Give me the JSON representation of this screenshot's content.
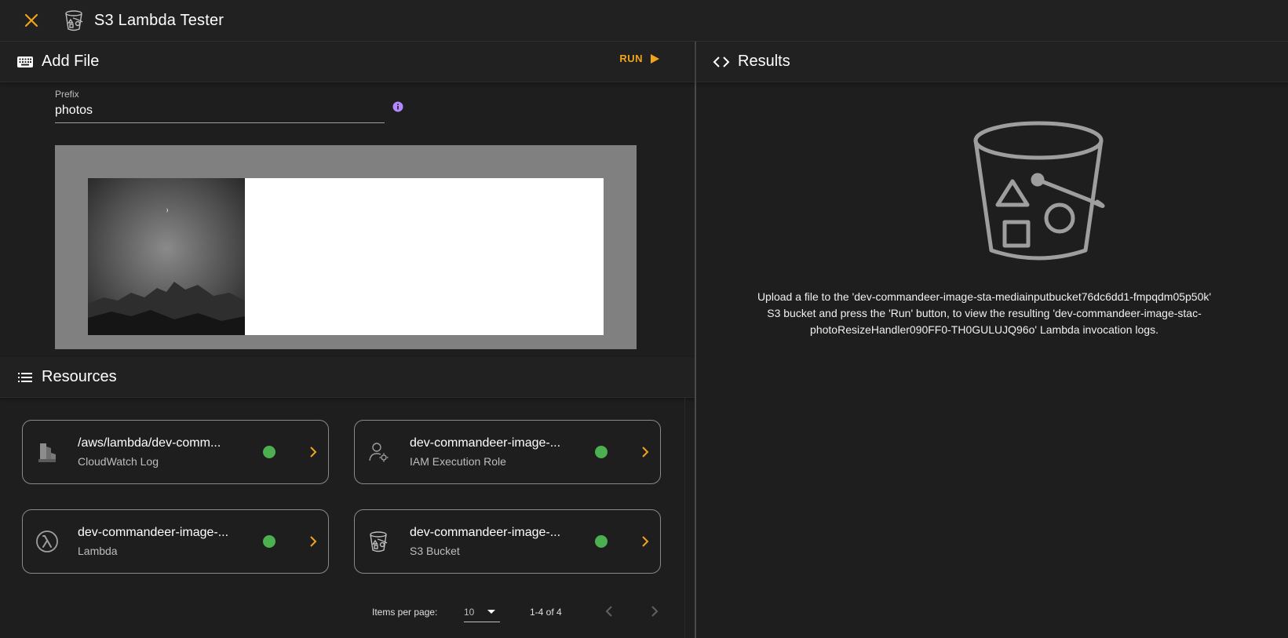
{
  "app": {
    "title": "S3 Lambda Tester",
    "accent_color": "#f0a41c",
    "close_icon": "close-icon",
    "app_icon": "s3-bucket-icon"
  },
  "add_file": {
    "title": "Add File",
    "icon": "keyboard-icon",
    "run_label": "RUN",
    "prefix_label": "Prefix",
    "prefix_value": "photos"
  },
  "resources": {
    "title": "Resources",
    "icon": "list-icon",
    "items": [
      {
        "name": "/aws/lambda/dev-comm...",
        "type": "CloudWatch Log",
        "icon": "cloudwatch-log-icon",
        "status_color": "#4caf50"
      },
      {
        "name": "dev-commandeer-image-...",
        "type": "IAM Execution Role",
        "icon": "iam-role-icon",
        "status_color": "#4caf50"
      },
      {
        "name": "dev-commandeer-image-...",
        "type": "Lambda",
        "icon": "lambda-icon",
        "status_color": "#4caf50"
      },
      {
        "name": "dev-commandeer-image-...",
        "type": "S3 Bucket",
        "icon": "s3-bucket-icon",
        "status_color": "#4caf50"
      }
    ],
    "pager": {
      "items_per_page_label": "Items per page:",
      "items_per_page_value": "10",
      "range_label": "1-4 of 4"
    }
  },
  "results": {
    "title": "Results",
    "icon": "code-icon",
    "message_line1": "Upload a file to the 'dev-commandeer-image-sta-mediainputbucket76dc6dd1-fmpqdm05p50k'",
    "message_line2": "S3 bucket and press the 'Run' button, to view the resulting 'dev-commandeer-image-stac-",
    "message_line3": "photoResizeHandler090FF0-TH0GULUJQ96o' Lambda invocation logs."
  }
}
